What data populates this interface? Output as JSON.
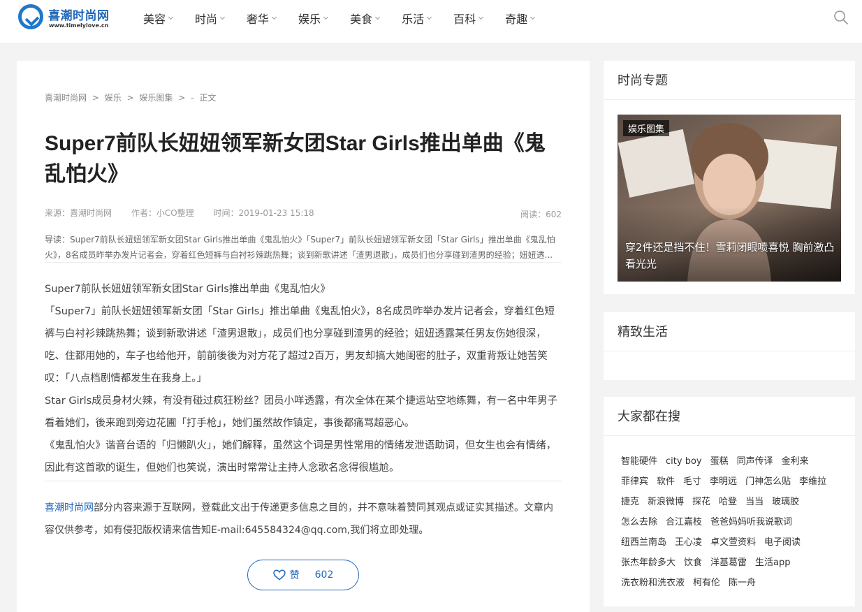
{
  "header": {
    "logo_name": "喜潮时尚网",
    "logo_url": "www.timelylove.cn",
    "nav": [
      "美容",
      "时尚",
      "奢华",
      "娱乐",
      "美食",
      "乐活",
      "百科",
      "奇趣"
    ],
    "accent_color": "#1f66b8"
  },
  "article": {
    "breadcrumb": [
      "喜潮时尚网",
      ">",
      "娱乐",
      ">",
      "娱乐图集",
      ">",
      "-",
      "正文"
    ],
    "title": "Super7前队长妞妞领军新女团Star Girls推出单曲《鬼乱怕火》",
    "meta": {
      "source": "来源：喜潮时尚网",
      "author": "作者：小CO整理",
      "time": "时间：2019-01-23 15:18",
      "reads": "阅读：602"
    },
    "summary": "导读：Super7前队长妞妞领军新女团Star Girls推出单曲《鬼乱怕火》「Super7」前队长妞妞领军新女团「Star Girls」推出单曲《鬼乱怕火》，8名成员昨举办发片记者会，穿着红色短裤与白衬衫辣跳热舞；谈到新歌讲述「渣男退散」，成员们也分享碰到渣男的经验；妞妞透...",
    "paragraphs": [
      "Super7前队长妞妞领军新女团Star Girls推出单曲《鬼乱怕火》",
      "「Super7」前队长妞妞领军新女团「Star Girls」推出单曲《鬼乱怕火》，8名成员昨举办发片记者会，穿着红色短裤与白衬衫辣跳热舞；谈到新歌讲述「渣男退散」，成员们也分享碰到渣男的经验；妞妞透露某任男友伤她很深，吃、住都用她的，车子也给他开，前前後後为对方花了超过2百万，男友却搞大她闺密的肚子，双重背叛让她苦笑叹：「八点档剧情都发生在我身上。」",
      "Star Girls成员身材火辣，有没有碰过疯狂粉丝？团员小咩透露，有次全体在某个捷运站空地练舞，有一名中年男子看着她们，後来跑到旁边花圃「打手枪」，她们虽然故作镇定，事後都痛骂超恶心。",
      "《鬼乱怕火》谐音台语的「归懒趴火」，她们解释，虽然这个词是男性常用的情绪发泄语助词，但女生也会有情绪，因此有这首歌的诞生，但她们也笑说，演出时常常让主持人念歌名念得很尴尬。"
    ],
    "notice_link": "喜潮时尚网",
    "notice_text": "部分内容来源于互联网，登载此文出于传递更多信息之目的，并不意味着赞同其观点或证实其描述。文章内容仅供参考，如有侵犯版权请来信告知E-mail:645584324@qq.com,我们将立即处理。",
    "like_label": "赞",
    "like_count": "602"
  },
  "sidebar": {
    "topic_title": "时尚专题",
    "feature_tag": "娱乐图集",
    "feature_caption": "穿2件还是挡不住！雪莉闭眼喷喜悦 胸前激凸看光光",
    "life_title": "精致生活",
    "search_title": "大家都在搜",
    "tags": [
      "智能硬件",
      "city boy",
      "蛋糕",
      "同声传译",
      "金利来",
      "菲律宾",
      "软件",
      "毛寸",
      "李明远",
      "门神怎么贴",
      "李维拉",
      "捷克",
      "新浪微博",
      "探花",
      "哈登",
      "当当",
      "玻璃胶",
      "怎么去除",
      "合江嘉枝",
      "爸爸妈妈听我说歌词",
      "纽西兰南岛",
      "王心凌",
      "卓文萱资料",
      "电子阅读",
      "张杰年龄多大",
      "饮食",
      "洋基葛雷",
      "生活app",
      "洗衣粉和洗衣液",
      "柯有伦",
      "陈一舟"
    ]
  }
}
